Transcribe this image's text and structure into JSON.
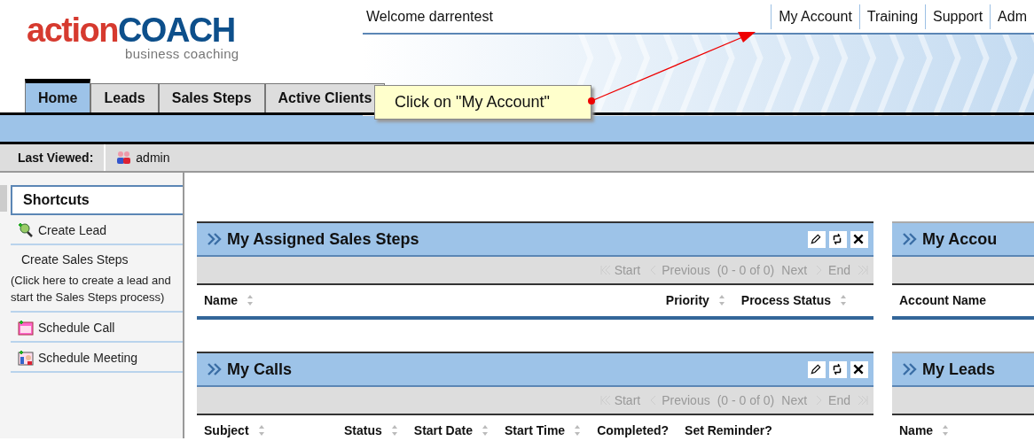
{
  "logo": {
    "brand_first": "action",
    "brand_second": "COACH",
    "tagline": "business coaching"
  },
  "welcome": "Welcome darrentest",
  "top_links": [
    "My Account",
    "Training",
    "Support",
    "Adm"
  ],
  "tabs": [
    {
      "label": "Home",
      "selected": true
    },
    {
      "label": "Leads",
      "selected": false
    },
    {
      "label": "Sales Steps",
      "selected": false
    },
    {
      "label": "Active Clients",
      "selected": false
    }
  ],
  "callout": {
    "text": "Click on \"My Account\""
  },
  "last_viewed": {
    "label": "Last Viewed:",
    "item": "admin"
  },
  "sidebar": {
    "title": "Shortcuts",
    "items": [
      {
        "label": "Create Lead",
        "kind": "lead"
      },
      {
        "label": "Create Sales Steps",
        "kind": "text",
        "note": "(Click here to create a lead and start the Sales Steps process)"
      },
      {
        "label": "Schedule Call",
        "kind": "call"
      },
      {
        "label": "Schedule Meeting",
        "kind": "meeting"
      }
    ]
  },
  "portlets": [
    {
      "title": "My Assigned Sales Steps",
      "tools": true,
      "pager": [
        "Start",
        "Previous",
        "(0 - 0 of 0)",
        "Next",
        "End"
      ],
      "columns": [
        {
          "label": "Name",
          "sortable": true
        },
        {
          "label": "Priority",
          "sortable": true
        },
        {
          "label": "Process Status",
          "sortable": true
        }
      ]
    },
    {
      "title": "My Accou",
      "tools": false,
      "columns": [
        {
          "label": "Account Name",
          "sortable": false
        }
      ]
    },
    {
      "title": "My Calls",
      "tools": true,
      "pager": [
        "Start",
        "Previous",
        "(0 - 0 of 0)",
        "Next",
        "End"
      ],
      "columns": [
        {
          "label": "Subject",
          "sortable": true
        },
        {
          "label": "Status",
          "sortable": true
        },
        {
          "label": "Start Date",
          "sortable": true
        },
        {
          "label": "Start Time",
          "sortable": true
        },
        {
          "label": "Completed?",
          "sortable": false
        },
        {
          "label": "Set Reminder?",
          "sortable": false
        }
      ]
    },
    {
      "title": "My Leads",
      "tools": false,
      "columns": [
        {
          "label": "Name",
          "sortable": true
        }
      ]
    }
  ]
}
